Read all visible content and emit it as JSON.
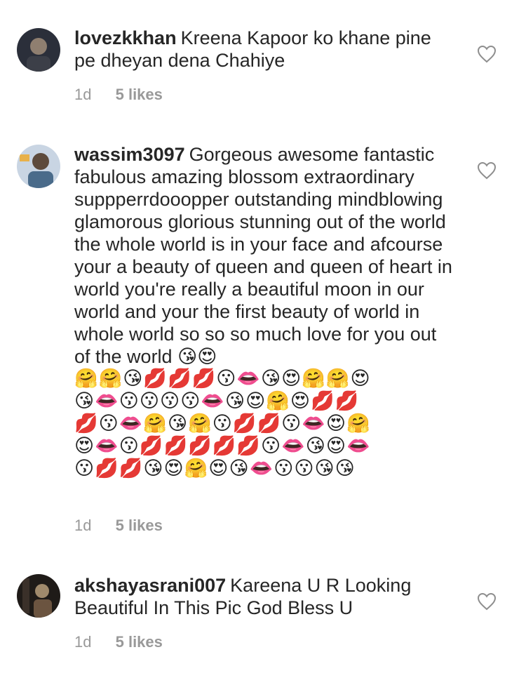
{
  "comments": [
    {
      "username": "lovezkkhan",
      "text": "Kreena Kapoor ko khane pine pe dheyan dena Chahiye",
      "time": "1d",
      "likes": "5 likes",
      "avatar_colors": [
        "#2b2f3a",
        "#8f7f70"
      ]
    },
    {
      "username": "wassim3097",
      "text": "Gorgeous awesome fantastic fabulous amazing blossom extraordinary suppperrdooopper outstanding mindblowing glamorous glorious stunning out of the world the whole world is in your face and afcourse your a beauty of queen and queen of heart in world you're really a beautiful moon in our world and your the first beauty of world in whole world so so so much love for you out of the world 😘😍",
      "emoji_rows": [
        "🤗🤗😘💋💋💋😗👄😘😍🤗🤗😍",
        "😘👄😗😗😗😗👄😘😍🤗😍💋💋",
        "💋😗👄🤗😘🤗😗💋💋😗👄😍🤗",
        "😍👄😗💋💋💋💋💋😗👄😘😍👄",
        "😗💋💋😘😍🤗😍😘👄😗😗😘😘"
      ],
      "time": "1d",
      "likes": "5 likes",
      "avatar_colors": [
        "#c9d5e3",
        "#5d4a3c"
      ]
    },
    {
      "username": "akshayasrani007",
      "text": "Kareena U R Looking Beautiful In This Pic God Bless U",
      "time": "1d",
      "likes": "5 likes",
      "avatar_colors": [
        "#1f1b18",
        "#a08a6c"
      ]
    }
  ]
}
